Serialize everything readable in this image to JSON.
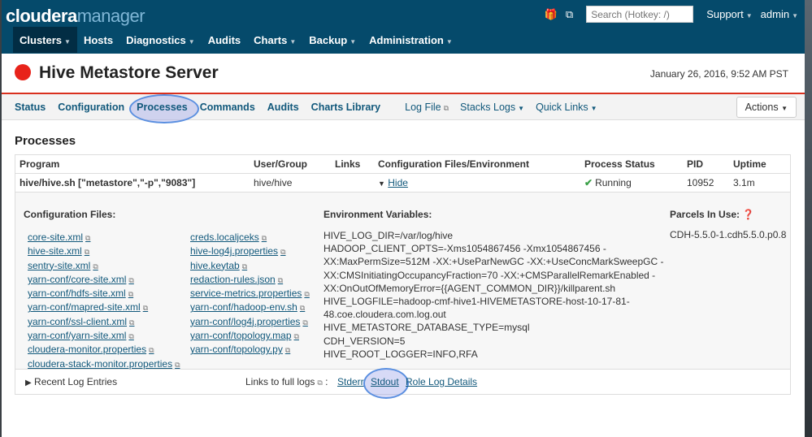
{
  "brand": {
    "name1": "cloudera",
    "name2": "manager"
  },
  "topnav": {
    "items": [
      {
        "label": "Clusters",
        "caret": true
      },
      {
        "label": "Hosts"
      },
      {
        "label": "Diagnostics",
        "caret": true
      },
      {
        "label": "Audits"
      },
      {
        "label": "Charts",
        "caret": true
      },
      {
        "label": "Backup",
        "caret": true
      },
      {
        "label": "Administration",
        "caret": true
      }
    ],
    "search_placeholder": "Search (Hotkey: /)",
    "support": "Support",
    "admin": "admin"
  },
  "header": {
    "title": "Hive Metastore Server",
    "date": "January 26, 2016, 9:52 AM PST",
    "status_color": "#e8231a"
  },
  "tabs": {
    "items": [
      "Status",
      "Configuration",
      "Processes",
      "Commands",
      "Audits",
      "Charts Library"
    ],
    "log_file": "Log File",
    "stacks_logs": "Stacks Logs",
    "quick_links": "Quick Links",
    "actions": "Actions"
  },
  "processes": {
    "heading": "Processes",
    "columns": [
      "Program",
      "User/Group",
      "Links",
      "Configuration Files/Environment",
      "Process Status",
      "PID",
      "Uptime"
    ],
    "row": {
      "program": "hive/hive.sh [\"metastore\",\"-p\",\"9083\"]",
      "user": "hive/hive",
      "links": "",
      "config": "Hide",
      "status": "Running",
      "pid": "10952",
      "uptime": "3.1m"
    },
    "config_label": "Configuration Files:",
    "config_files_col1": [
      "core-site.xml",
      "hive-site.xml",
      "sentry-site.xml",
      "yarn-conf/core-site.xml",
      "yarn-conf/hdfs-site.xml",
      "yarn-conf/mapred-site.xml",
      "yarn-conf/ssl-client.xml",
      "yarn-conf/yarn-site.xml",
      "cloudera-monitor.properties",
      "cloudera-stack-monitor.properties"
    ],
    "config_files_col2": [
      "creds.localjceks",
      "hive-log4j.properties",
      "hive.keytab",
      "redaction-rules.json",
      "service-metrics.properties",
      "yarn-conf/hadoop-env.sh",
      "yarn-conf/log4j.properties",
      "yarn-conf/topology.map",
      "yarn-conf/topology.py"
    ],
    "env_label": "Environment Variables:",
    "env_lines": [
      "HIVE_LOG_DIR=/var/log/hive",
      "HADOOP_CLIENT_OPTS=-Xms1054867456 -Xmx1054867456 -",
      "XX:MaxPermSize=512M -XX:+UseParNewGC -XX:+UseConcMarkSweepGC -",
      "XX:CMSInitiatingOccupancyFraction=70 -XX:+CMSParallelRemarkEnabled -",
      "XX:OnOutOfMemoryError={{AGENT_COMMON_DIR}}/killparent.sh",
      "HIVE_LOGFILE=hadoop-cmf-hive1-HIVEMETASTORE-host-10-17-81-",
      "48.coe.cloudera.com.log.out",
      "HIVE_METASTORE_DATABASE_TYPE=mysql",
      "CDH_VERSION=5",
      "HIVE_ROOT_LOGGER=INFO,RFA"
    ],
    "parcels_label": "Parcels In Use:",
    "parcel": "CDH-5.5.0-1.cdh5.5.0.p0.8",
    "recent_logs": "Recent Log Entries",
    "full_logs": "Links to full logs",
    "stderr": "Stderr",
    "stdout": "Stdout",
    "role_log": "Role Log Details"
  }
}
